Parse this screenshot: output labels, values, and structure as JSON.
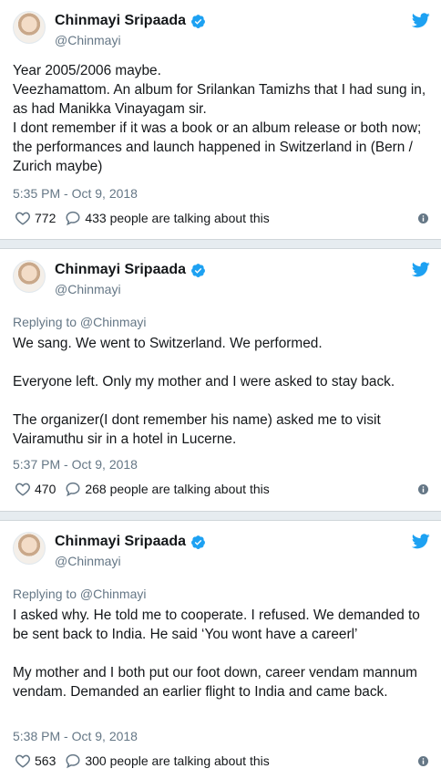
{
  "tweets": [
    {
      "name": "Chinmayi Sripaada",
      "handle": "@Chinmayi",
      "replying": "",
      "text": "Year 2005/2006 maybe.\nVeezhamattom. An album for Srilankan Tamizhs that I had sung in, as had Manikka Vinayagam sir.\nI dont remember if it was a book or an album release or both now; the performances and launch happened in Switzerland in (Bern / Zurich maybe)",
      "time": "5:35 PM - Oct 9, 2018",
      "likes": "772",
      "talking": "433 people are talking about this"
    },
    {
      "name": "Chinmayi Sripaada",
      "handle": "@Chinmayi",
      "replying": "Replying to @Chinmayi",
      "text": "We sang. We went to Switzerland. We performed.\n\nEveryone left. Only my mother and I were asked to stay back.\n\nThe organizer(I dont remember his name) asked me to visit Vairamuthu sir in a hotel in Lucerne.",
      "time": "5:37 PM - Oct 9, 2018",
      "likes": "470",
      "talking": "268 people are talking about this"
    },
    {
      "name": "Chinmayi Sripaada",
      "handle": "@Chinmayi",
      "replying": "Replying to @Chinmayi",
      "text": "I asked why. He told me to cooperate. I refused. We demanded to be sent back to India. He said ‘You wont have a careerl’\n\nMy mother and I both put our foot down, career vendam mannum vendam. Demanded an earlier flight to India and came back.",
      "time": "5:38 PM - Oct 9, 2018",
      "likes": "563",
      "talking": "300 people are talking about this"
    }
  ],
  "colors": {
    "accent": "#1da1f2",
    "muted": "#657786",
    "separator": "#e6ecf0"
  },
  "icons": [
    "verified-badge-icon",
    "twitter-bird-icon",
    "heart-icon",
    "speech-bubble-icon",
    "info-icon"
  ]
}
